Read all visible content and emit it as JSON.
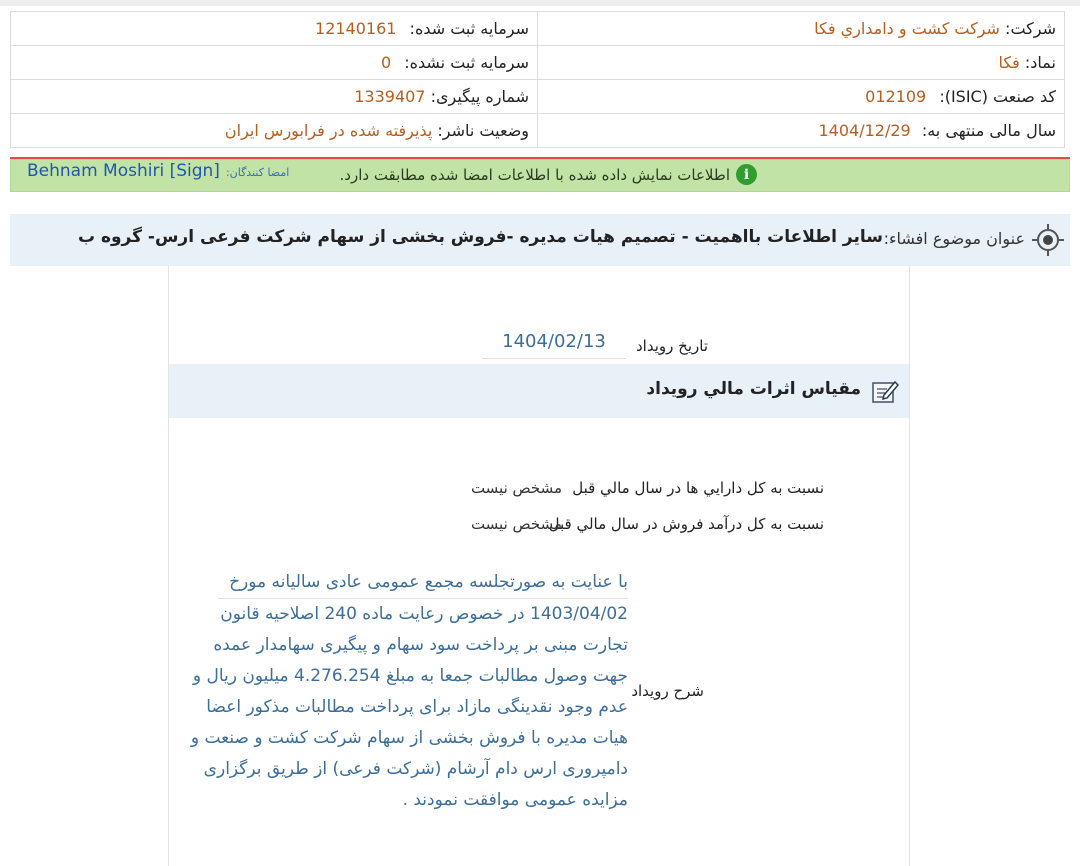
{
  "header": {
    "company_label": "شرکت:",
    "company_value": "شركت كشت و دامداري فكا",
    "capital_registered_label": "سرمايه ثبت شده:",
    "capital_registered_value": "12140161",
    "symbol_label": "نماد:",
    "symbol_value": "فكا",
    "capital_unregistered_label": "سرمايه ثبت نشده:",
    "capital_unregistered_value": "0",
    "isic_label": "كد صنعت (ISIC):",
    "isic_value": "012109",
    "tracking_label": "شماره پيگيری:",
    "tracking_value": "1339407",
    "fiscal_label": "سال مالی منتهی به:",
    "fiscal_value": "1404/12/29",
    "publisher_status_label": "وضعيت ناشر:",
    "publisher_status_value": "پذيرفته شده در فرابورس ايران"
  },
  "verification": {
    "message": "اطلاعات نمايش داده شده با اطلاعات امضا شده مطابقت دارد.",
    "signers_label": "امضا كنندگان:",
    "signer_name": "Behnam Moshiri [Sign]"
  },
  "subject": {
    "label": "عنوان موضوع افشاء:",
    "title": "ساير اطلاعات بااهميت - تصميم هيات مديره -فروش بخشی از سهام شركت فرعی ارس- گروه ب"
  },
  "event": {
    "date_label": "تاريخ رويداد",
    "date_value": "1404/02/13",
    "section_title": "مقياس اثرات مالي رويداد",
    "ratio_assets_label": "نسبت به كل دارايي ها در سال مالي قبل",
    "ratio_assets_value": "مشخص نيست",
    "ratio_revenue_label": "نسبت به كل درآمد فروش در سال مالي قبل",
    "ratio_revenue_value": "مشخص نيست",
    "description_label": "شرح رويداد",
    "description_lines": [
      "با عنايت به صورتجلسه مجمع عمومی عادی ساليانه مورخ",
      "1403/04/02 در خصوص رعايت ماده 240 اصلاحيه قانون",
      "تجارت مبنی بر پرداخت سود سهام و پيگيری سهامدار عمده",
      "جهت وصول مطالبات جمعا به مبلغ 4.276.254 ميليون ريال و",
      "عدم وجود نقدينگی مازاد برای پرداخت مطالبات مذكور اعضا",
      "هيات مديره با فروش بخشی از سهام شركت كشت و صنعت و",
      "دامپروری ارس دام آرشام (شركت فرعی) از طريق برگزاری",
      "مزايده عمومی موافقت نمودند ."
    ]
  },
  "colors": {
    "value_orange": "#b85d1e",
    "link_blue": "#3d6e9a",
    "verify_green": "#c2e3a6",
    "panel_blue": "#e8f0f8"
  },
  "icons": {
    "verify": "info-circle-icon",
    "subject": "target-icon",
    "section": "edit-note-icon"
  }
}
